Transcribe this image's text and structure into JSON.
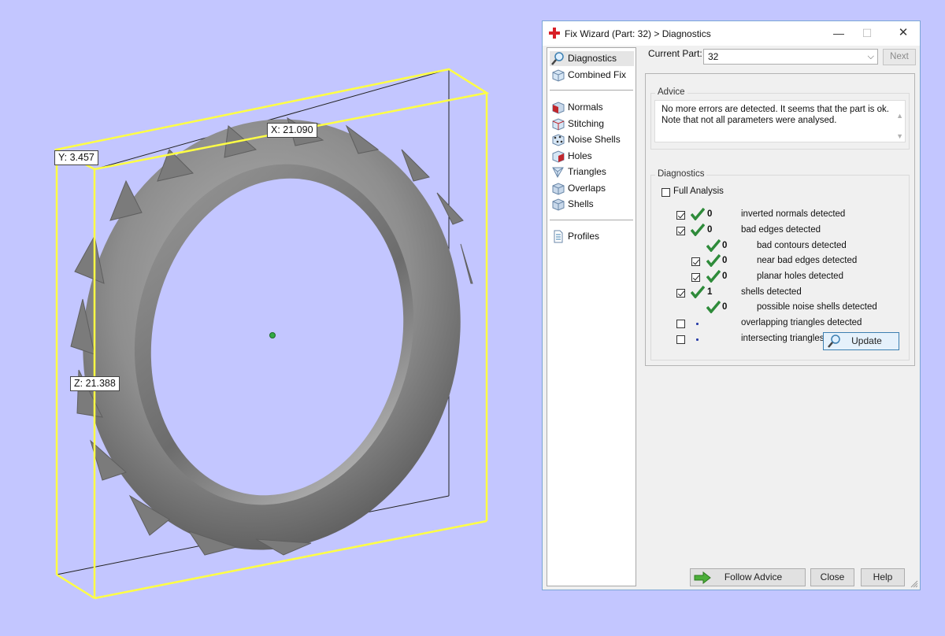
{
  "viewport": {
    "dims": {
      "x_label": "X: 21.090",
      "y_label": "Y: 3.457",
      "z_label": "Z: 21.388"
    },
    "background": "#c3c6ff",
    "box_color": "#ffff44"
  },
  "window": {
    "title": "Fix Wizard (Part: 32) > Diagnostics",
    "controls": {
      "minimize": "—",
      "maximize": "☐",
      "close": "✕"
    }
  },
  "nav": {
    "items": [
      {
        "label": "Diagnostics",
        "icon": "magnifier-icon"
      },
      {
        "label": "Combined Fix",
        "icon": "cube-icon"
      },
      {
        "label": "Normals",
        "icon": "normals-cube-icon"
      },
      {
        "label": "Stitching",
        "icon": "stitching-cube-icon"
      },
      {
        "label": "Noise Shells",
        "icon": "noise-shells-icon"
      },
      {
        "label": "Holes",
        "icon": "holes-cube-icon"
      },
      {
        "label": "Triangles",
        "icon": "triangles-icon"
      },
      {
        "label": "Overlaps",
        "icon": "overlaps-cube-icon"
      },
      {
        "label": "Shells",
        "icon": "shells-cube-icon"
      },
      {
        "label": "Profiles",
        "icon": "profiles-document-icon"
      }
    ]
  },
  "header": {
    "part_label": "Current Part:",
    "part_value": "32",
    "next_label": "Next"
  },
  "advice": {
    "title": "Advice",
    "line1": "No more errors are detected. It seems that the part is ok.",
    "line2": "Note that not all parameters were analysed."
  },
  "diagnostics": {
    "title": "Diagnostics",
    "full_analysis": "Full Analysis",
    "rows": [
      {
        "count": "0",
        "label": "inverted normals detected"
      },
      {
        "count": "0",
        "label": "bad edges detected"
      },
      {
        "count": "0",
        "label": "bad contours detected"
      },
      {
        "count": "0",
        "label": "near bad edges detected"
      },
      {
        "count": "0",
        "label": "planar holes detected"
      },
      {
        "count": "1",
        "label": "shells detected"
      },
      {
        "count": "0",
        "label": "possible noise shells detected"
      },
      {
        "count": "",
        "label": "overlapping triangles detected"
      },
      {
        "count": "",
        "label": "intersecting triangles detected"
      }
    ],
    "update_label": "Update"
  },
  "footer": {
    "follow_advice": "Follow Advice",
    "close": "Close",
    "help": "Help"
  },
  "colors": {
    "check_green": "#2e8b3a",
    "accent_blue": "#3c7fb1"
  }
}
